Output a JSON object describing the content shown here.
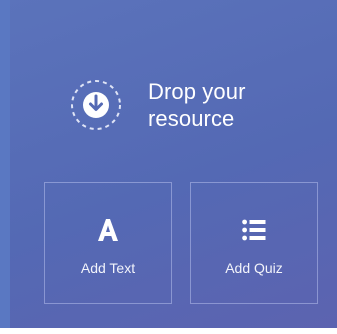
{
  "dropzone": {
    "icon": "download-circle-icon",
    "label": "Drop your resource"
  },
  "actions": [
    {
      "label": "Add Text",
      "icon": "letter-a-icon"
    },
    {
      "label": "Add Quiz",
      "icon": "list-icon"
    }
  ],
  "colors": {
    "panel_background": "#5469b4",
    "panel_edge": "#5a78c2",
    "foreground": "#ffffff",
    "tile_border": "#b4beeb"
  }
}
